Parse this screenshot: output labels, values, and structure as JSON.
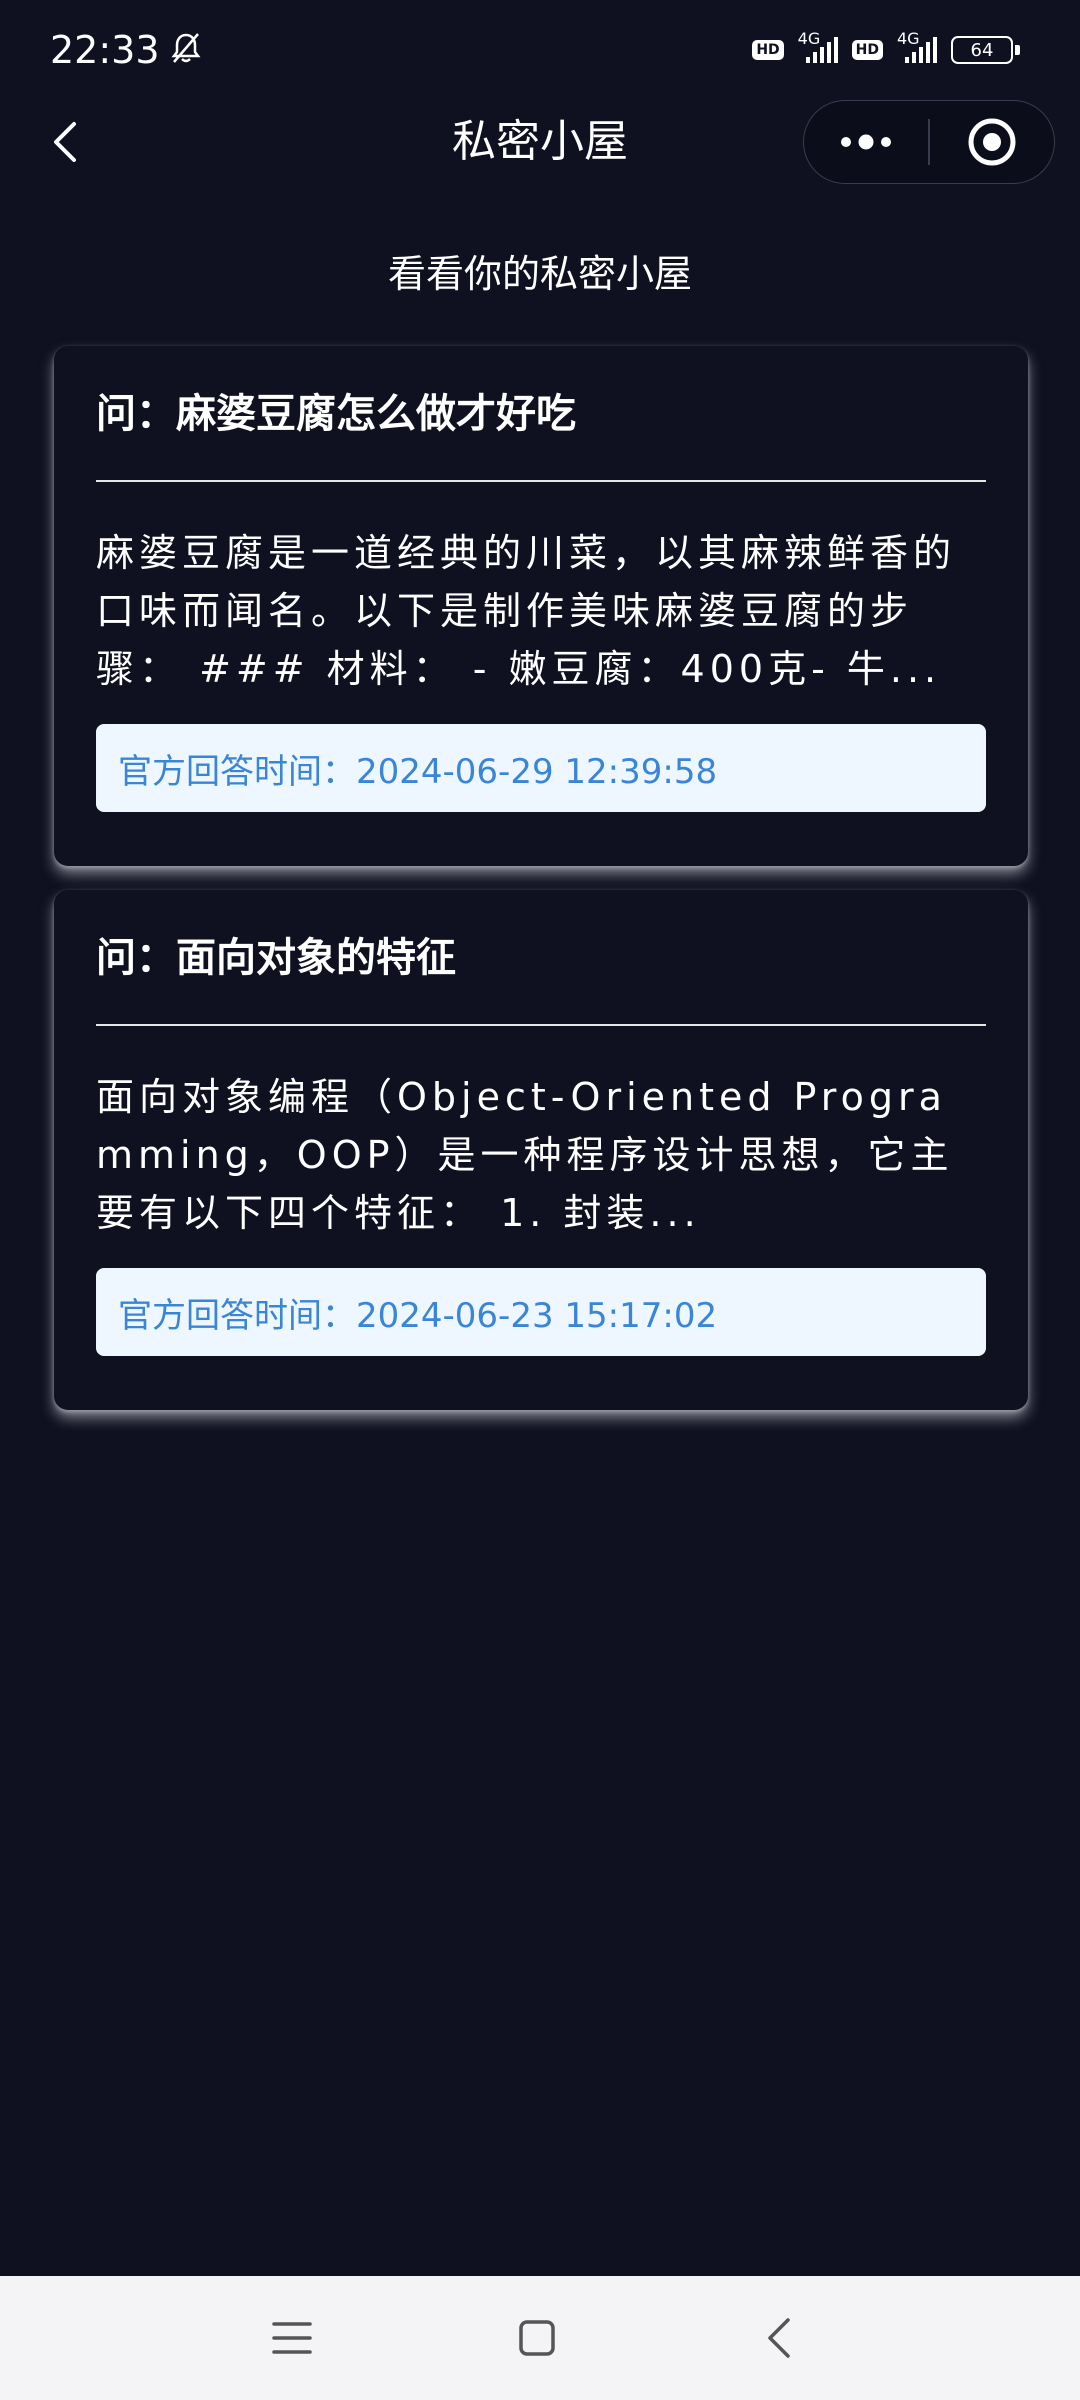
{
  "status_bar": {
    "time": "22:33",
    "hd_label": "HD",
    "network_label": "4G",
    "battery": "64"
  },
  "nav": {
    "title": "私密小屋"
  },
  "subtitle": "看看你的私密小屋",
  "cards": [
    {
      "question": "问：麻婆豆腐怎么做才好吃",
      "answer": "麻婆豆腐是一道经典的川菜，以其麻辣鲜香的口味而闻名。以下是制作美味麻婆豆腐的步骤： ### 材料： - 嫩豆腐：400克- 牛...",
      "time": "官方回答时间：2024-06-29 12:39:58"
    },
    {
      "question": "问：面向对象的特征",
      "answer": "面向对象编程（Object-Oriented Programming，OOP）是一种程序设计思想，它主要有以下四个特征： 1. 封装...",
      "time": "官方回答时间：2024-06-23 15:17:02"
    }
  ],
  "icons": {
    "mute": "bell-off-icon",
    "back": "chevron-left-icon",
    "more": "more-dots-icon",
    "close": "target-close-icon",
    "menu": "menu-icon",
    "home": "home-square-icon",
    "system_back": "system-back-icon"
  },
  "colors": {
    "background": "#0f1020",
    "time_box_bg": "#eef6ff",
    "time_text": "#3a86d6",
    "bottom_nav_bg": "#f4f4f6"
  }
}
